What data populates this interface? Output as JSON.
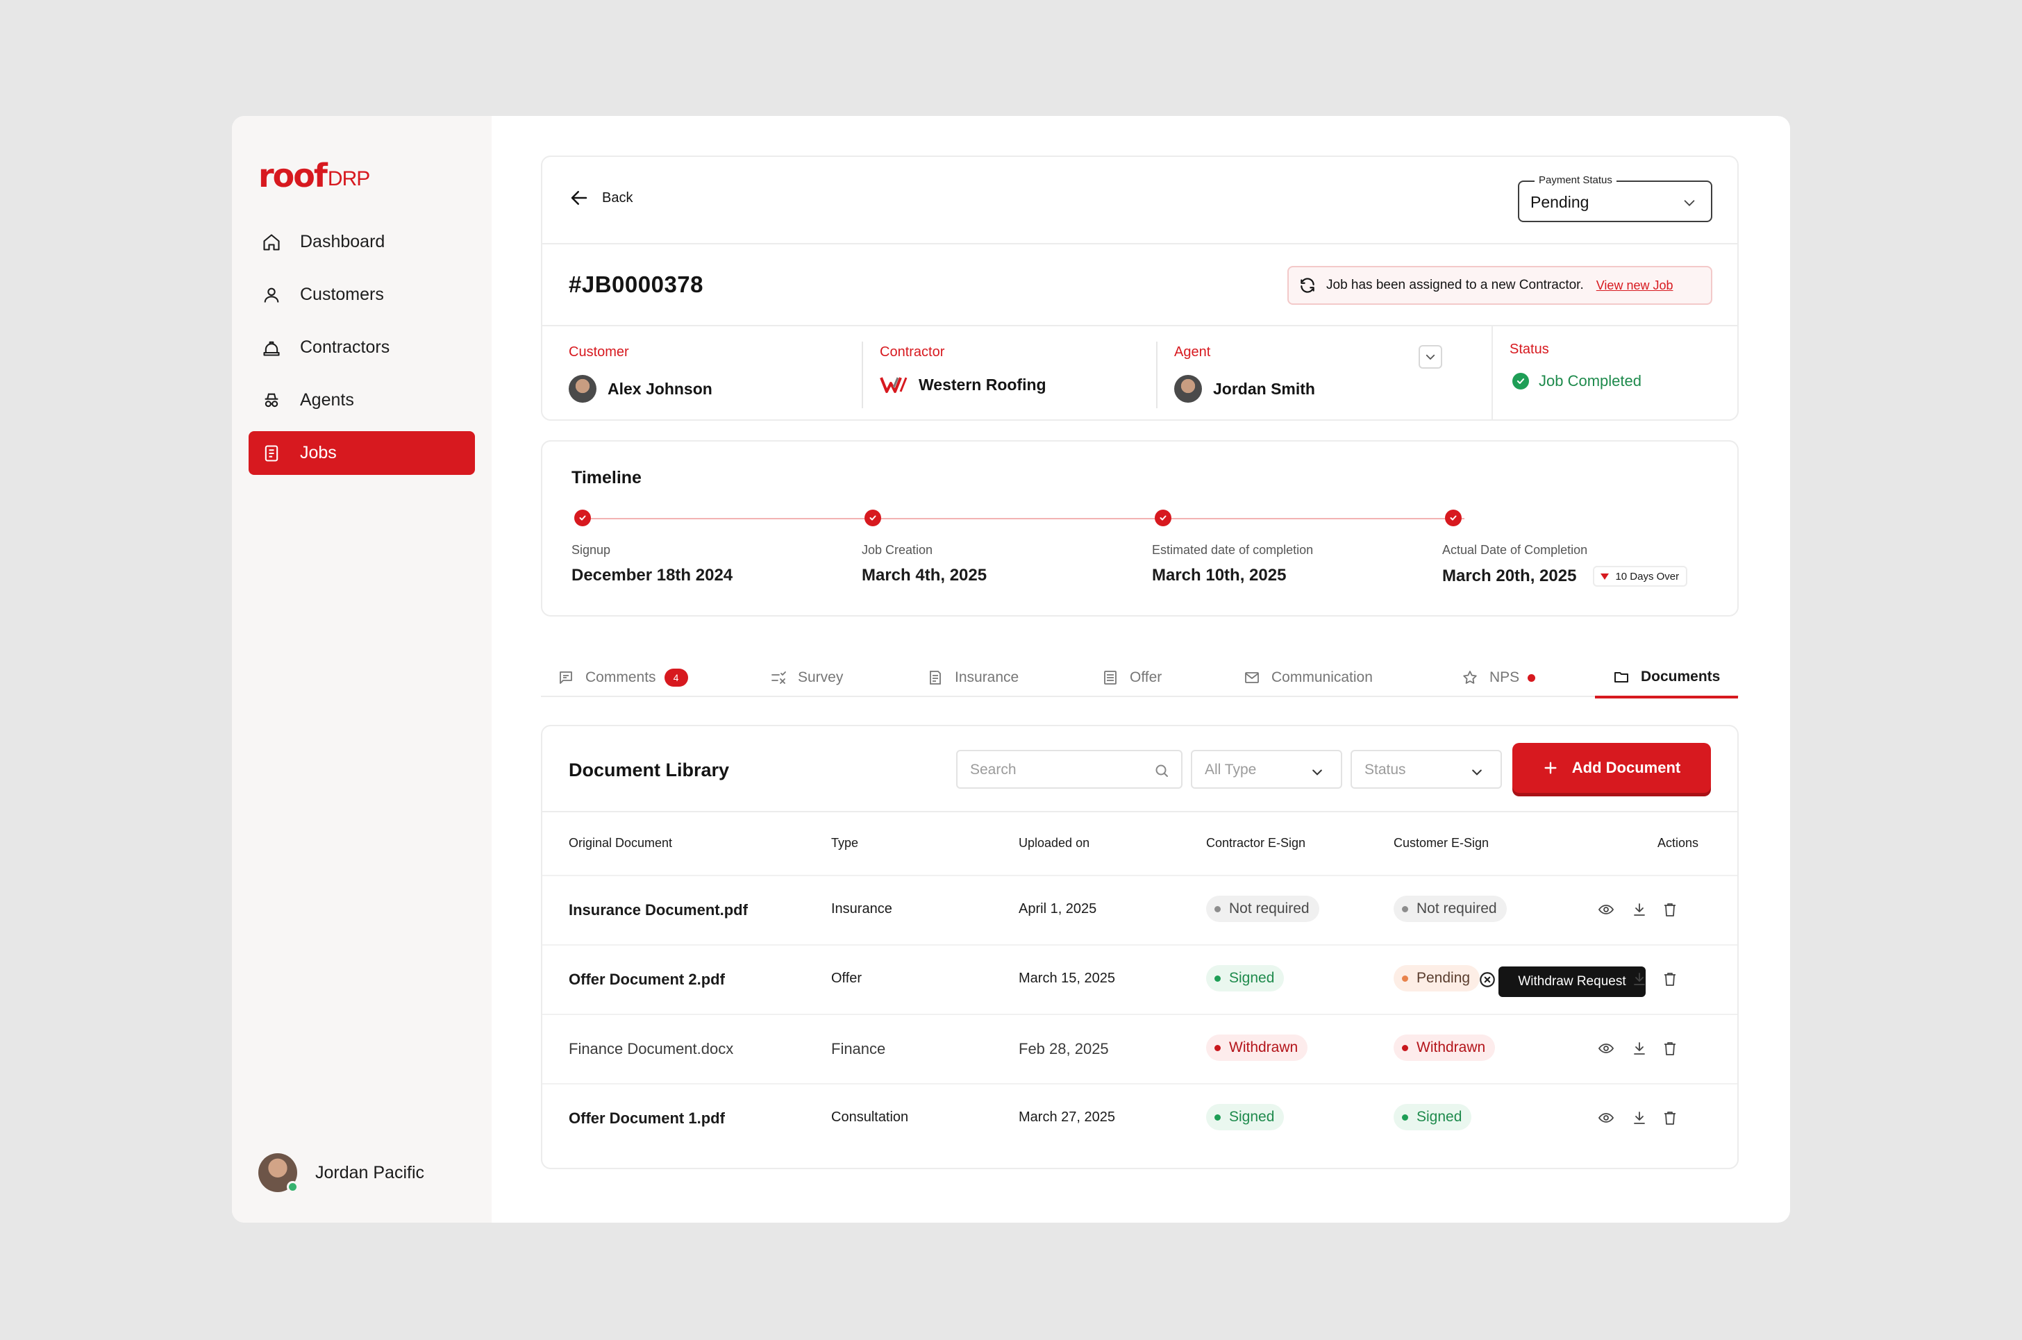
{
  "brand": {
    "logo_main": "roof",
    "logo_suffix": "DRP",
    "accent": "#d7191f"
  },
  "sidebar": {
    "items": [
      {
        "label": "Dashboard",
        "icon": "home-icon"
      },
      {
        "label": "Customers",
        "icon": "user-icon"
      },
      {
        "label": "Contractors",
        "icon": "hard-hat-icon"
      },
      {
        "label": "Agents",
        "icon": "agent-icon"
      },
      {
        "label": "Jobs",
        "icon": "clipboard-icon",
        "active": true
      }
    ],
    "user_name": "Jordan Pacific"
  },
  "header": {
    "back_label": "Back",
    "payment_status_label": "Payment Status",
    "payment_status_value": "Pending",
    "job_id": "#JB0000378",
    "alert_text": "Job has been assigned to a new Contractor.",
    "alert_link": "View new Job"
  },
  "people": {
    "customer_label": "Customer",
    "customer_name": "Alex Johnson",
    "contractor_label": "Contractor",
    "contractor_name": "Western Roofing",
    "agent_label": "Agent",
    "agent_name": "Jordan Smith",
    "status_label": "Status",
    "status_value": "Job Completed"
  },
  "timeline": {
    "title": "Timeline",
    "steps": [
      {
        "label": "Signup",
        "date": "December 18th 2024"
      },
      {
        "label": "Job Creation",
        "date": "March 4th, 2025"
      },
      {
        "label": "Estimated date of completion",
        "date": "March 10th, 2025"
      },
      {
        "label": "Actual Date of Completion",
        "date": "March 20th, 2025",
        "badge": "10 Days Over"
      }
    ]
  },
  "tabs": [
    {
      "label": "Comments",
      "count": "4"
    },
    {
      "label": "Survey"
    },
    {
      "label": "Insurance"
    },
    {
      "label": "Offer"
    },
    {
      "label": "Communication"
    },
    {
      "label": "NPS"
    },
    {
      "label": "Documents",
      "active": true
    }
  ],
  "documents": {
    "title": "Document Library",
    "search_placeholder": "Search",
    "type_filter": "All Type",
    "status_filter": "Status",
    "add_label": "Add Document",
    "columns": [
      "Original Document",
      "Type",
      "Uploaded on",
      "Contractor E-Sign",
      "Customer E-Sign",
      "Actions"
    ],
    "rows": [
      {
        "name": "Insurance Document.pdf",
        "type": "Insurance",
        "uploaded": "April 1, 2025",
        "contractor": "Not required",
        "customer": "Not required"
      },
      {
        "name": "Offer Document 2.pdf",
        "type": "Offer",
        "uploaded": "March 15, 2025",
        "contractor": "Signed",
        "customer": "Pending"
      },
      {
        "name": "Finance Document.docx",
        "type": "Finance",
        "uploaded": "Feb 28, 2025",
        "contractor": "Withdrawn",
        "customer": "Withdrawn"
      },
      {
        "name": "Offer Document 1.pdf",
        "type": "Consultation",
        "uploaded": "March 27, 2025",
        "contractor": "Signed",
        "customer": "Signed"
      }
    ],
    "tooltip": "Withdraw Request"
  }
}
